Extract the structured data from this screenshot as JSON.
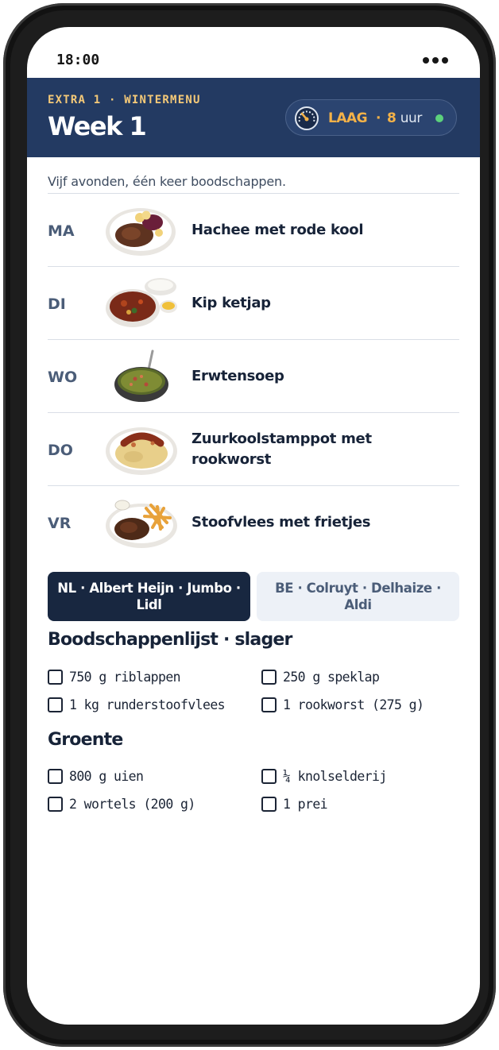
{
  "status_bar": {
    "time": "18:00"
  },
  "header": {
    "eyebrow": "EXTRA 1 · WINTERMENU",
    "title": "Week 1",
    "effort": {
      "level": "LAAG",
      "separator": "·",
      "amount": "8",
      "unit": "uur"
    },
    "colors": {
      "background": "#233a62",
      "accent": "#f4b248",
      "status": "#5cd17c"
    }
  },
  "intro": "Vijf avonden, één keer boodschappen.",
  "menu": [
    {
      "day": "MA",
      "dish": "Hachee met rode kool",
      "image": "hachee-plate"
    },
    {
      "day": "DI",
      "dish": "Kip ketjap",
      "image": "kip-ketjap-bowl"
    },
    {
      "day": "WO",
      "dish": "Erwtensoep",
      "image": "erwtensoep-pan"
    },
    {
      "day": "DO",
      "dish": "Zuurkoolstamppot met rookworst",
      "image": "zuurkool-plate"
    },
    {
      "day": "VR",
      "dish": "Stoofvlees met frietjes",
      "image": "stoofvlees-plate"
    }
  ],
  "store_tabs": [
    {
      "label": "NL · Albert Heijn · Jumbo · Lidl",
      "selected": true
    },
    {
      "label": "BE · Colruyt · Delhaize · Aldi",
      "selected": false
    }
  ],
  "shopping_list": {
    "sections": [
      {
        "title": "Boodschappenlijst · slager",
        "items": [
          "750 g riblappen",
          "250 g speklap",
          "1 kg runderstoofvlees",
          "1 rookworst (275 g)"
        ]
      },
      {
        "title": "Groente",
        "items": [
          "800 g uien",
          "¼ knolselderij",
          "2 wortels (200 g)",
          "1 prei"
        ]
      }
    ]
  }
}
